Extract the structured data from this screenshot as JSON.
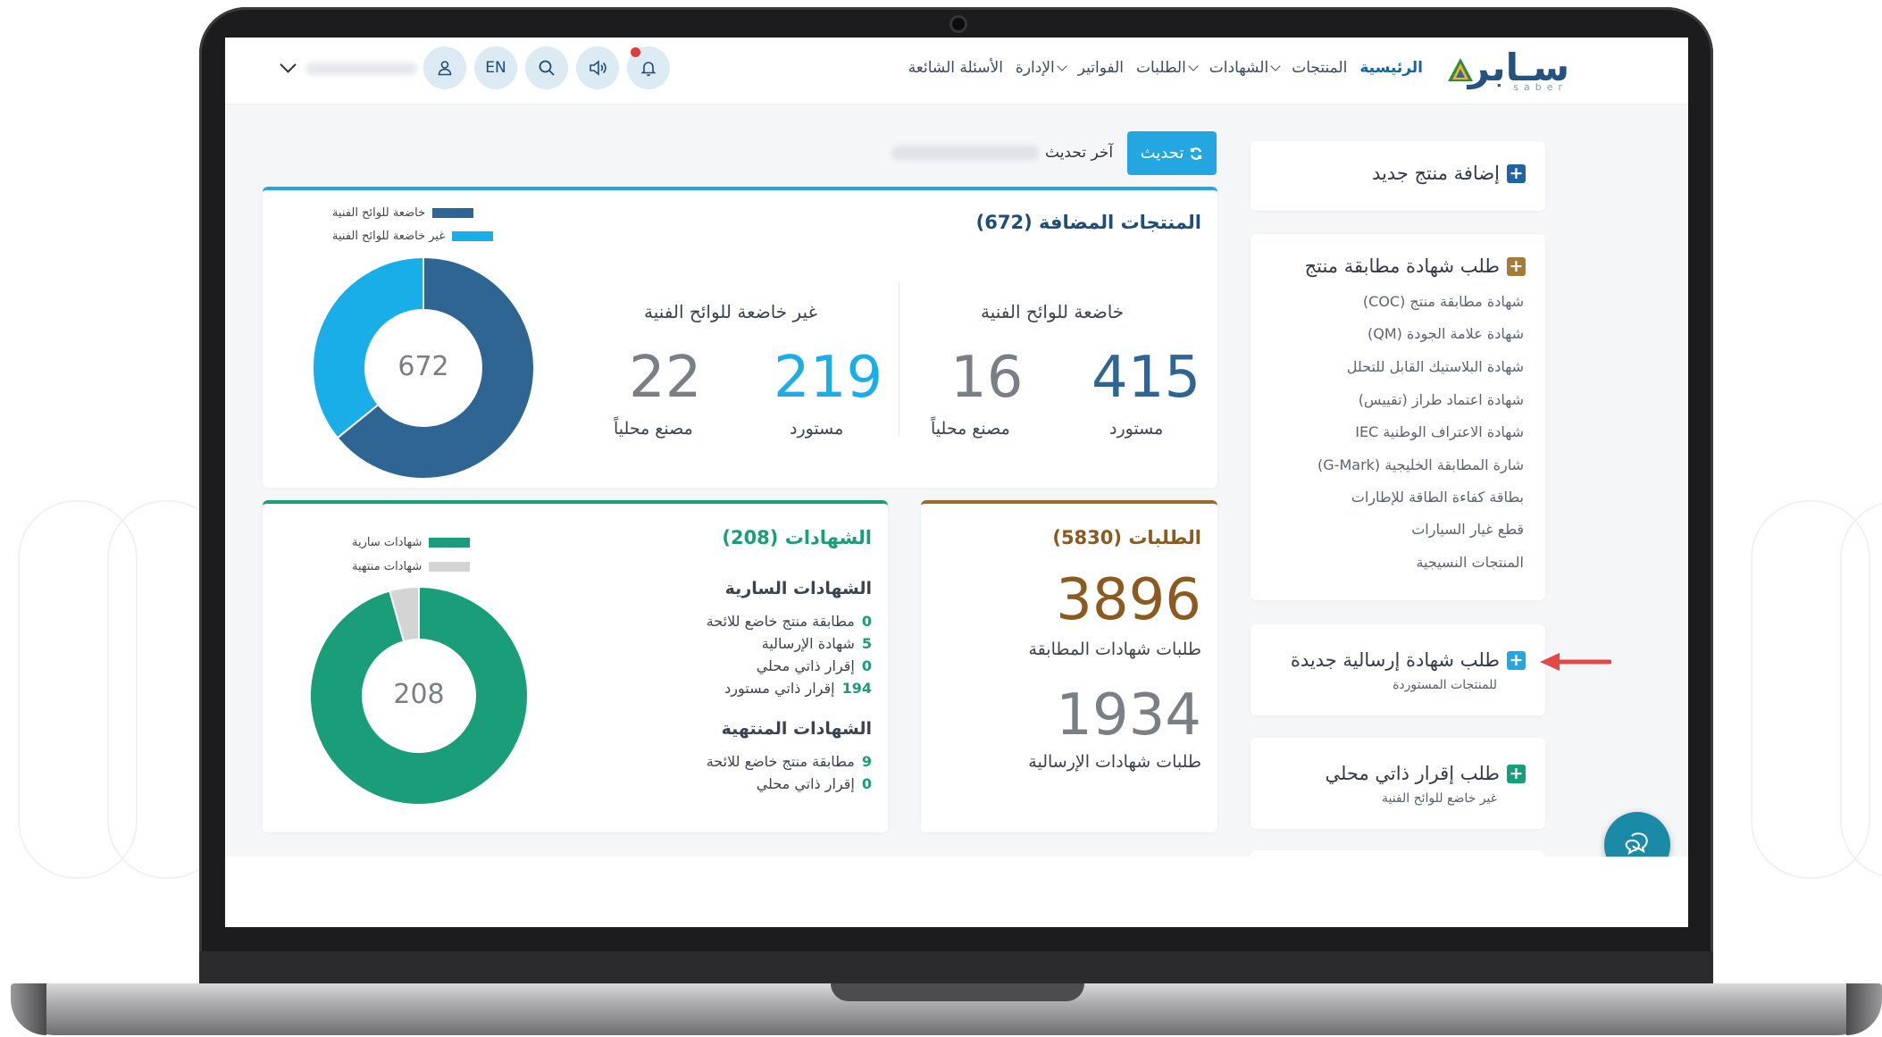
{
  "logo": {
    "text": "سـابر",
    "sub": "saber"
  },
  "nav": {
    "items": [
      {
        "label": "الرئيسية",
        "active": true,
        "dropdown": false
      },
      {
        "label": "المنتجات",
        "active": false,
        "dropdown": false
      },
      {
        "label": "الشهادات",
        "active": false,
        "dropdown": true
      },
      {
        "label": "الطلبات",
        "active": false,
        "dropdown": true
      },
      {
        "label": "الفواتير",
        "active": false,
        "dropdown": false
      },
      {
        "label": "الإدارة",
        "active": false,
        "dropdown": true
      },
      {
        "label": "الأسئلة الشائعة",
        "active": false,
        "dropdown": false
      }
    ]
  },
  "header": {
    "lang_label": "EN"
  },
  "toolbar": {
    "refresh_label": "تحديث",
    "last_update_label": "آخر تحديث"
  },
  "sidebar": {
    "add_product": "إضافة منتج جديد",
    "coc_request": {
      "title": "طلب شهادة مطابقة منتج",
      "links": [
        "شهادة مطابقة منتج (COC)",
        "شهادة علامة الجودة (QM)",
        "شهادة البلاستيك القابل للتحلل",
        "شهادة اعتماد طراز (تقييس)",
        "شهادة الاعتراف الوطنية IEC",
        "شارة المطابقة الخليجية (G-Mark)",
        "بطاقة كفاءة الطاقة للإطارات",
        "قطع غيار السيارات",
        "المنتجات النسيجية"
      ]
    },
    "shipment_request": {
      "title": "طلب شهادة إرسالية جديدة",
      "sub": "للمنتجات المستوردة"
    },
    "self_declaration": {
      "title": "طلب إقرار ذاتي محلي",
      "sub": "غير خاضع للوائح الفنية"
    }
  },
  "products": {
    "title": "المنتجات المضافة",
    "total": "(672)",
    "regulated": {
      "title": "خاضعة للوائح الفنية",
      "imported": "415",
      "imported_label": "مستورد",
      "local": "16",
      "local_label": "مصنع محلياً"
    },
    "non_regulated": {
      "title": "غير خاضعة للوائح الفنية",
      "imported": "219",
      "imported_label": "مستورد",
      "local": "22",
      "local_label": "مصنع محلياً"
    },
    "donut_center": "672",
    "legend": [
      "خاضعة للوائح الفنية",
      "غير خاضعة للوائح الفنية"
    ],
    "colors": [
      "#2e6593",
      "#1aaee9"
    ]
  },
  "requests": {
    "title": "الطلبات",
    "total": "(5830)",
    "conformity_count": "3896",
    "conformity_label": "طلبات شهادات المطابقة",
    "shipment_count": "1934",
    "shipment_label": "طلبات شهادات الإرسالية",
    "accent": "#9a6b2c"
  },
  "certificates": {
    "title": "الشهادات",
    "total": "(208)",
    "active_title": "الشهادات السارية",
    "active": [
      {
        "count": "0",
        "label": "مطابقة منتج خاضع للائحة"
      },
      {
        "count": "5",
        "label": "شهادة الإرسالية"
      },
      {
        "count": "0",
        "label": "إقرار ذاتي محلي"
      },
      {
        "count": "194",
        "label": "إقرار ذاتي مستورد"
      }
    ],
    "expired_title": "الشهادات المنتهية",
    "expired": [
      {
        "count": "9",
        "label": "مطابقة منتج خاضع للائحة"
      },
      {
        "count": "0",
        "label": "إقرار ذاتي محلي"
      }
    ],
    "donut_center": "208",
    "legend": [
      "شهادات سارية",
      "شهادات منتهية"
    ],
    "colors": [
      "#1a9e7a",
      "#d4d4d4"
    ]
  }
}
